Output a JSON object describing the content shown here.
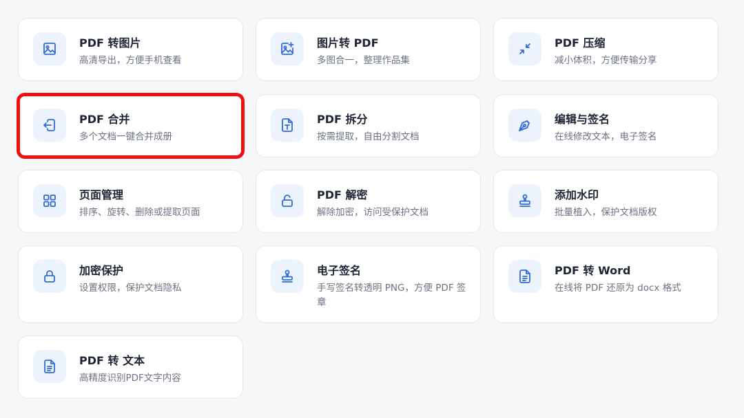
{
  "tools": [
    {
      "title": "PDF 转图片",
      "desc": "高清导出，方便手机查看",
      "icon": "image-icon"
    },
    {
      "title": "图片转 PDF",
      "desc": "多图合一，整理作品集",
      "icon": "image-add-icon"
    },
    {
      "title": "PDF 压缩",
      "desc": "减小体积，方便传输分享",
      "icon": "compress-icon"
    },
    {
      "title": "PDF 合并",
      "desc": "多个文档一键合并成册",
      "icon": "merge-icon"
    },
    {
      "title": "PDF 拆分",
      "desc": "按需提取，自由分割文档",
      "icon": "text-file-icon"
    },
    {
      "title": "编辑与签名",
      "desc": "在线修改文本，电子签名",
      "icon": "pen-nib-icon"
    },
    {
      "title": "页面管理",
      "desc": "排序、旋转、删除或提取页面",
      "icon": "grid-icon"
    },
    {
      "title": "PDF 解密",
      "desc": "解除加密，访问受保护文档",
      "icon": "unlock-icon"
    },
    {
      "title": "添加水印",
      "desc": "批量植入，保护文档版权",
      "icon": "stamp-icon"
    },
    {
      "title": "加密保护",
      "desc": "设置权限，保护文档隐私",
      "icon": "lock-icon"
    },
    {
      "title": "电子签名",
      "desc": "手写签名转透明 PNG，方便 PDF 签章",
      "icon": "stamp-icon"
    },
    {
      "title": "PDF 转 Word",
      "desc": "在线将 PDF 还原为 docx 格式",
      "icon": "document-icon"
    },
    {
      "title": "PDF 转 文本",
      "desc": "高精度识别PDF文字内容",
      "icon": "document-icon"
    }
  ],
  "highlighted_tool": "PDF 合并",
  "colors": {
    "accent": "#2f6bd8",
    "icon_bg": "#edf3fd",
    "highlight_border": "#ee0f0f",
    "page_bg": "#f6f7f9",
    "card_bg": "#ffffff"
  }
}
